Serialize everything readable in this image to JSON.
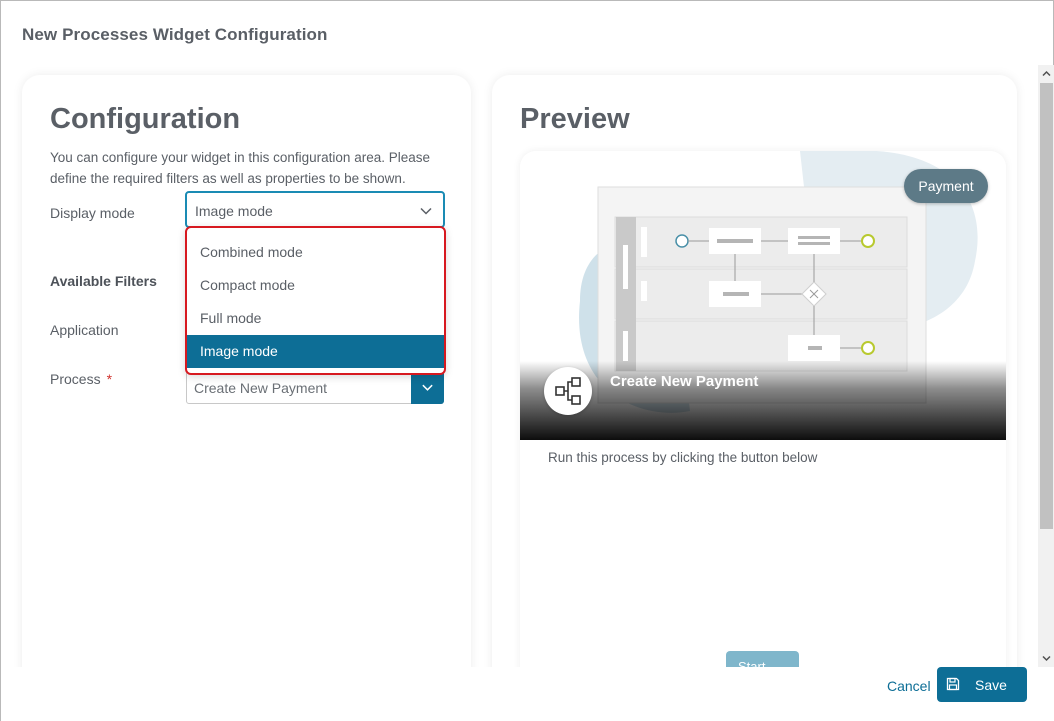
{
  "dialog": {
    "title": "New Processes Widget Configuration"
  },
  "config": {
    "heading": "Configuration",
    "description": "You can configure your widget in this configuration area. Please define the required filters as well as properties to be shown.",
    "display_mode_label": "Display mode",
    "display_mode_value": "Image mode",
    "available_filters_label": "Available Filters",
    "application_label": "Application",
    "process_label": "Process",
    "process_required_mark": "*",
    "process_value": "Create New Payment",
    "dropdown_options": [
      "Combined mode",
      "Compact mode",
      "Full mode",
      "Image mode"
    ],
    "selected_option": "Image mode"
  },
  "preview": {
    "heading": "Preview",
    "badge": "Payment",
    "card_title": "Create New Payment",
    "run_text": "Run this process by clicking the button below",
    "start_label": "Start"
  },
  "footer": {
    "cancel_label": "Cancel",
    "save_label": "Save"
  },
  "colors": {
    "primary": "#0d6e96",
    "focus_border": "#1a8bb4",
    "highlight_border": "#d71920",
    "badge": "#5d7a87",
    "heading_text": "#5a5f66"
  },
  "icons": {
    "select_chevron": "chevron-down-icon",
    "process": "process-flow-icon",
    "save": "floppy-disk-icon",
    "scroll_up": "scroll-up-arrow-icon",
    "scroll_down": "scroll-down-arrow-icon"
  }
}
